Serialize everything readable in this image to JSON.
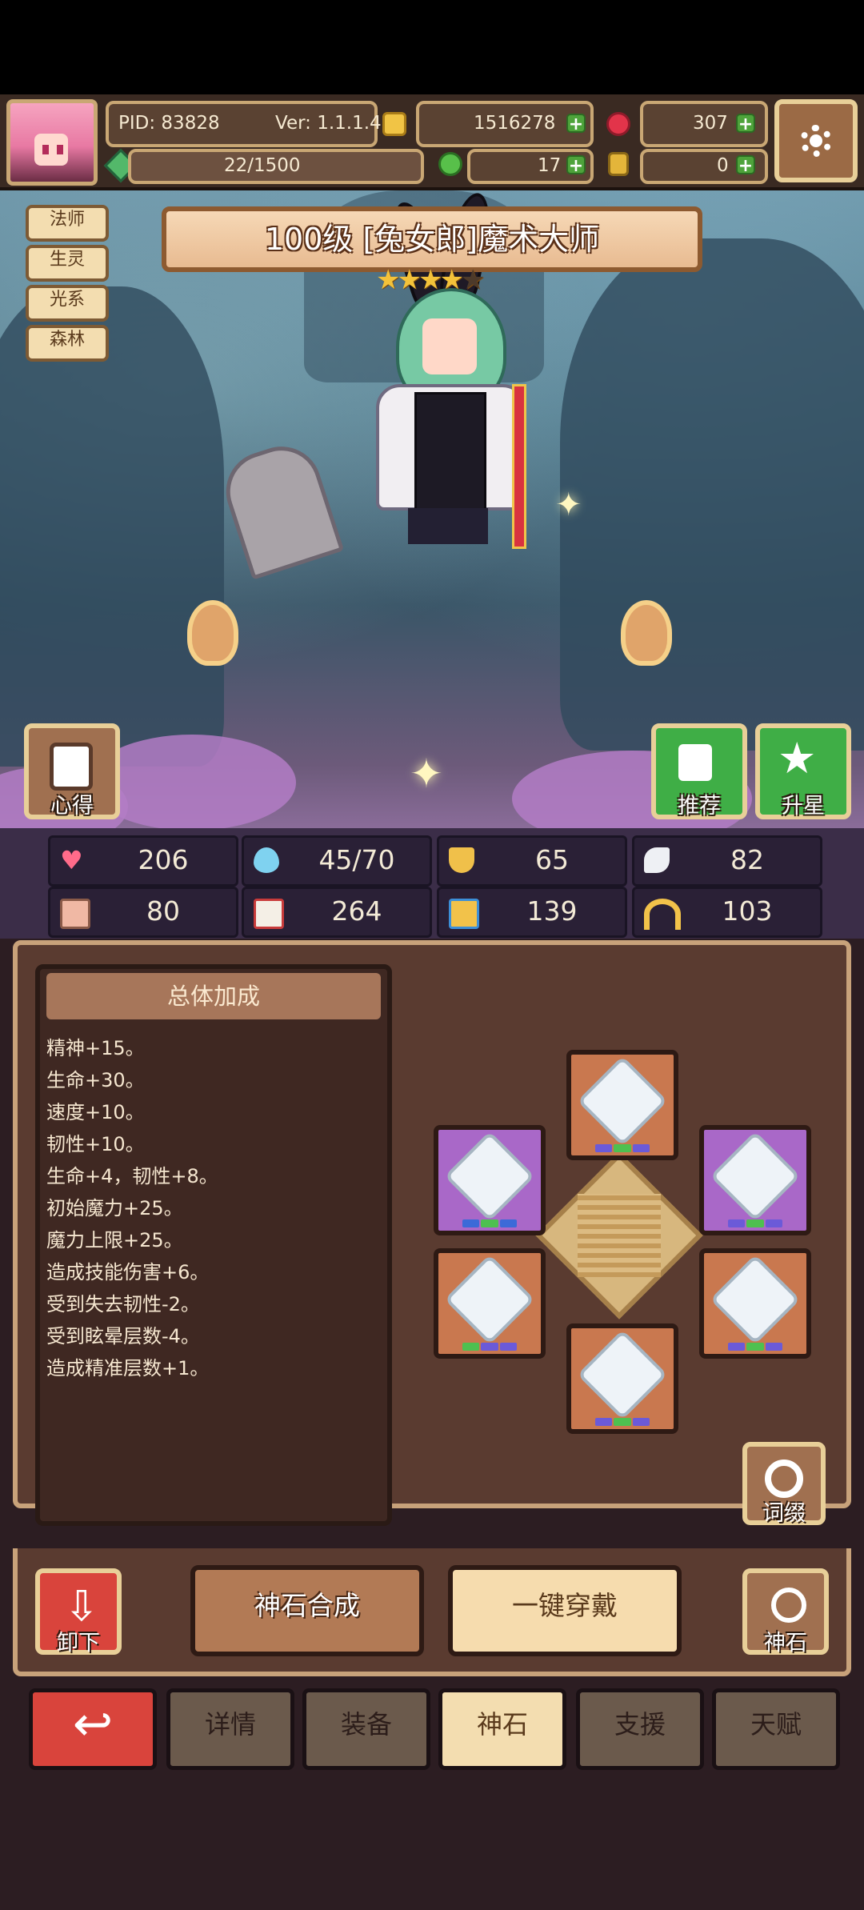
{
  "topbar": {
    "pid": "PID: 83828",
    "version": "Ver: 1.1.1.4",
    "gold": "1516278",
    "ruby": "307",
    "exp": "22/1500",
    "clover": "17",
    "bottle": "0"
  },
  "hero": {
    "title": "100级  [兔女郎]魔术大师",
    "stars_filled": 4,
    "stars_total": 5,
    "tags": [
      "法师",
      "生灵",
      "光系",
      "森林"
    ]
  },
  "scene_buttons": {
    "insight": "心得",
    "recommend": "推荐",
    "star_up": "升星"
  },
  "stats": [
    {
      "icon": "heart-icon",
      "value": "206"
    },
    {
      "icon": "mana-drop-icon",
      "value": "45/70"
    },
    {
      "icon": "shield-icon",
      "value": "65"
    },
    {
      "icon": "wing-icon",
      "value": "82"
    },
    {
      "icon": "fist-icon",
      "value": "80"
    },
    {
      "icon": "book-icon",
      "value": "264"
    },
    {
      "icon": "boot-icon",
      "value": "139"
    },
    {
      "icon": "horseshoe-icon",
      "value": "103"
    }
  ],
  "bonus": {
    "header": "总体加成",
    "lines": [
      "精神+15。",
      "生命+30。",
      "速度+10。",
      "韧性+10。",
      "生命+4，韧性+8。",
      "初始魔力+25。",
      "魔力上限+25。",
      "造成技能伤害+6。",
      "受到失去韧性-2。",
      "受到眩晕层数-4。",
      "造成精准层数+1。"
    ]
  },
  "gem_panel": {
    "affix_label": "词缀"
  },
  "actions": {
    "unequip": "卸下",
    "synthesize": "神石合成",
    "one_click_equip": "一键穿戴",
    "gemstone": "神石"
  },
  "nav": {
    "details": "详情",
    "equipment": "装备",
    "gemstone": "神石",
    "support": "支援",
    "talent": "天赋"
  },
  "colors": {
    "accent_gold": "#c9a774",
    "active_tab": "#f3ddb0",
    "back_button": "#d9443c"
  }
}
